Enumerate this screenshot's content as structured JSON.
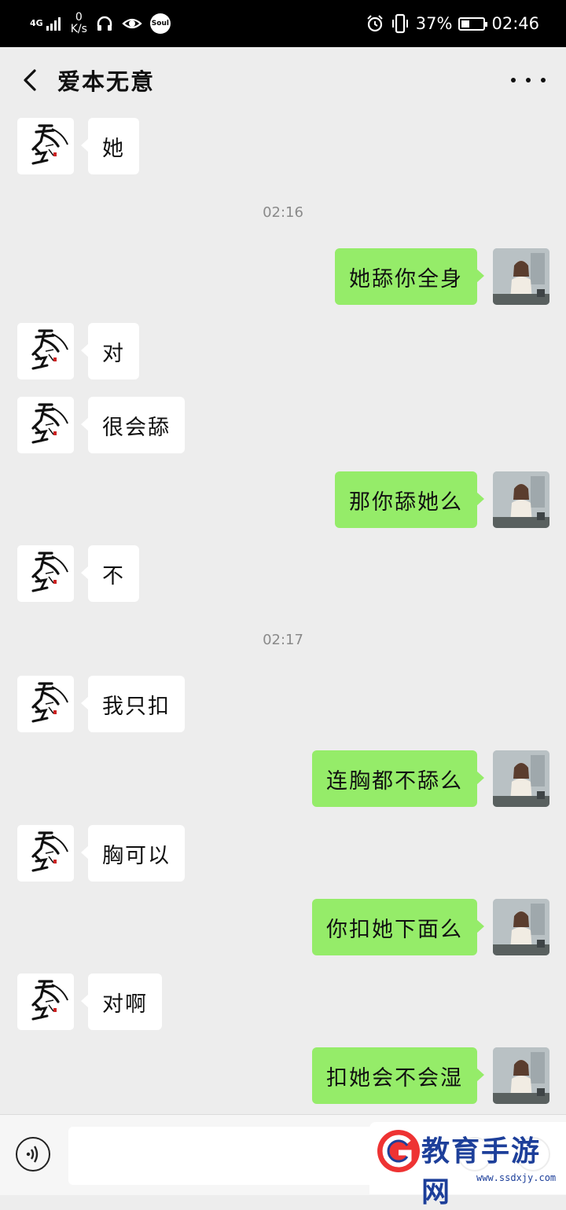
{
  "status_bar": {
    "network": "4G",
    "speed_value": "0",
    "speed_unit": "K/s",
    "soul_label": "Soul",
    "battery_text": "37%",
    "battery_level": 0.37,
    "time": "02:46"
  },
  "header": {
    "title": "爱本无意",
    "back_icon": "chevron-left-icon",
    "more_icon": "more-dots-icon"
  },
  "messages": [
    {
      "side": "left",
      "text": "她"
    },
    {
      "type": "time",
      "text": "02:16"
    },
    {
      "side": "right",
      "text": "她舔你全身"
    },
    {
      "side": "left",
      "text": "对"
    },
    {
      "side": "left",
      "text": "很会舔"
    },
    {
      "side": "right",
      "text": "那你舔她么"
    },
    {
      "side": "left",
      "text": "不"
    },
    {
      "type": "time",
      "text": "02:17"
    },
    {
      "side": "left",
      "text": "我只扣"
    },
    {
      "side": "right",
      "text": "连胸都不舔么"
    },
    {
      "side": "left",
      "text": "胸可以"
    },
    {
      "side": "right",
      "text": "你扣她下面么"
    },
    {
      "side": "left",
      "text": "对啊"
    },
    {
      "side": "right",
      "text": "扣她会不会湿"
    }
  ],
  "watermark": {
    "text": "教育手游网",
    "url": "www.ssdxjy.com"
  },
  "colors": {
    "outgoing_bubble": "#95ec69",
    "incoming_bubble": "#ffffff",
    "chat_background": "#ededed"
  }
}
